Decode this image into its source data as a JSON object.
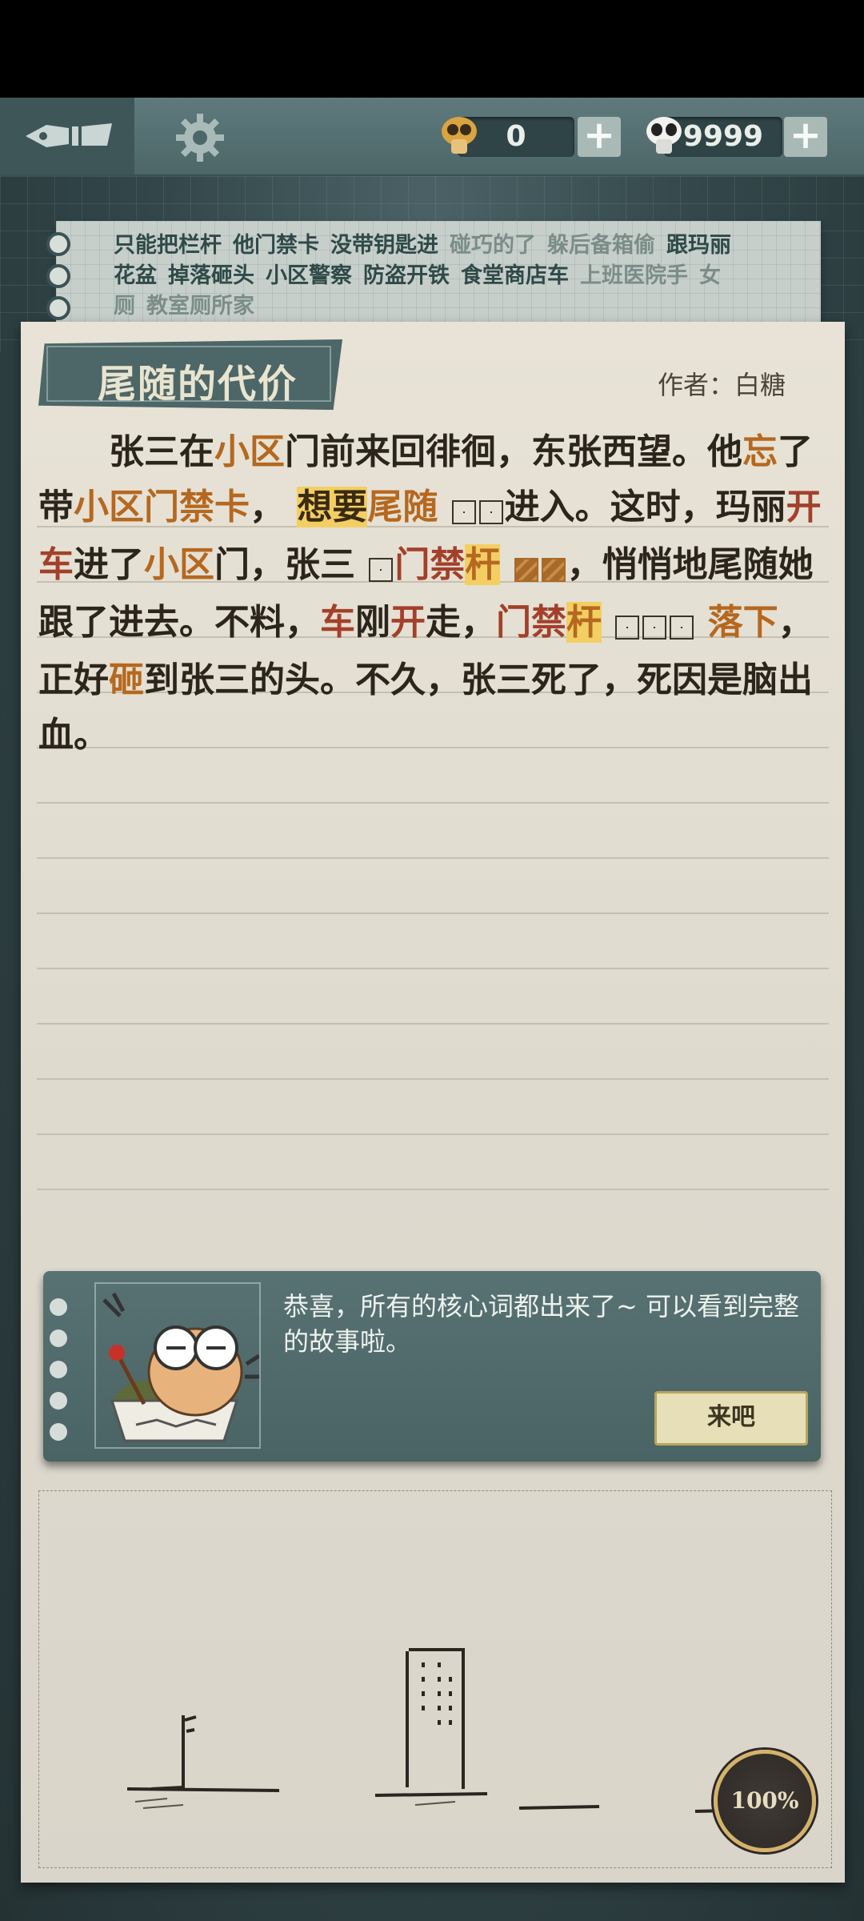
{
  "currency": {
    "hints": {
      "amount": "0",
      "plus": "+"
    },
    "coins": {
      "amount": "9999",
      "plus": "+"
    }
  },
  "keywords": {
    "line1": [
      {
        "text": "只能把栏杆",
        "state": "dark"
      },
      {
        "text": "他门禁卡",
        "state": "dark"
      },
      {
        "text": "没带钥匙进",
        "state": "dark"
      },
      {
        "text": "碰巧的了",
        "state": "light"
      },
      {
        "text": "躲后备箱偷",
        "state": "light"
      },
      {
        "text": "跟玛丽",
        "state": "dark"
      }
    ],
    "line2": [
      {
        "text": "花盆",
        "state": "dark"
      },
      {
        "text": "掉落砸头",
        "state": "dark"
      },
      {
        "text": "小区警察",
        "state": "dark"
      },
      {
        "text": "防盗开铁",
        "state": "dark"
      },
      {
        "text": "食堂商店车",
        "state": "dark"
      },
      {
        "text": "上班医院手",
        "state": "light"
      },
      {
        "text": "女",
        "state": "light"
      }
    ],
    "line3": [
      {
        "text": "厕",
        "state": "light"
      },
      {
        "text": "教室厕所家",
        "state": "light"
      }
    ]
  },
  "story": {
    "title": "尾随的代价",
    "author": "作者：白糖",
    "seg": {
      "s1": "张三在",
      "s2": "小区",
      "s3": "门前来回徘徊，东张西望。他",
      "s4": "忘",
      "s5": "了带",
      "s6": "小区",
      "s7": "门禁卡",
      "s8": "，",
      "s9": "想要",
      "s10": "尾随",
      "s11": "进入。这时，玛丽",
      "s12": "开车",
      "s13": "进了",
      "s14": "小区",
      "s15": "门，张三",
      "s16": "门禁",
      "s17": "杆",
      "s18": "，悄悄地尾随她跟了进去。不料，",
      "s19": "车",
      "s20": "刚",
      "s21": "开",
      "s22": "走，",
      "s23": "门禁",
      "s24": "杆",
      "s25": "落下",
      "s26": "，正好",
      "s27": "砸",
      "s28": "到张三的头。不久，张三死了，死因是脑出血。"
    }
  },
  "tip": {
    "message": "恭喜，所有的核心词都出来了~ 可以看到完整的故事啦。",
    "button": "来吧"
  },
  "progress": "100%",
  "icons": {
    "menu": "pen-icon",
    "settings": "gear-icon",
    "hints": "skull-coin-icon",
    "coins": "panda-coin-icon"
  },
  "colors": {
    "keyword_highlight": "#b5681f",
    "fill_highlight": "#f3cf63",
    "accent_red": "#a3402a",
    "panel_teal": "#4d6668"
  }
}
